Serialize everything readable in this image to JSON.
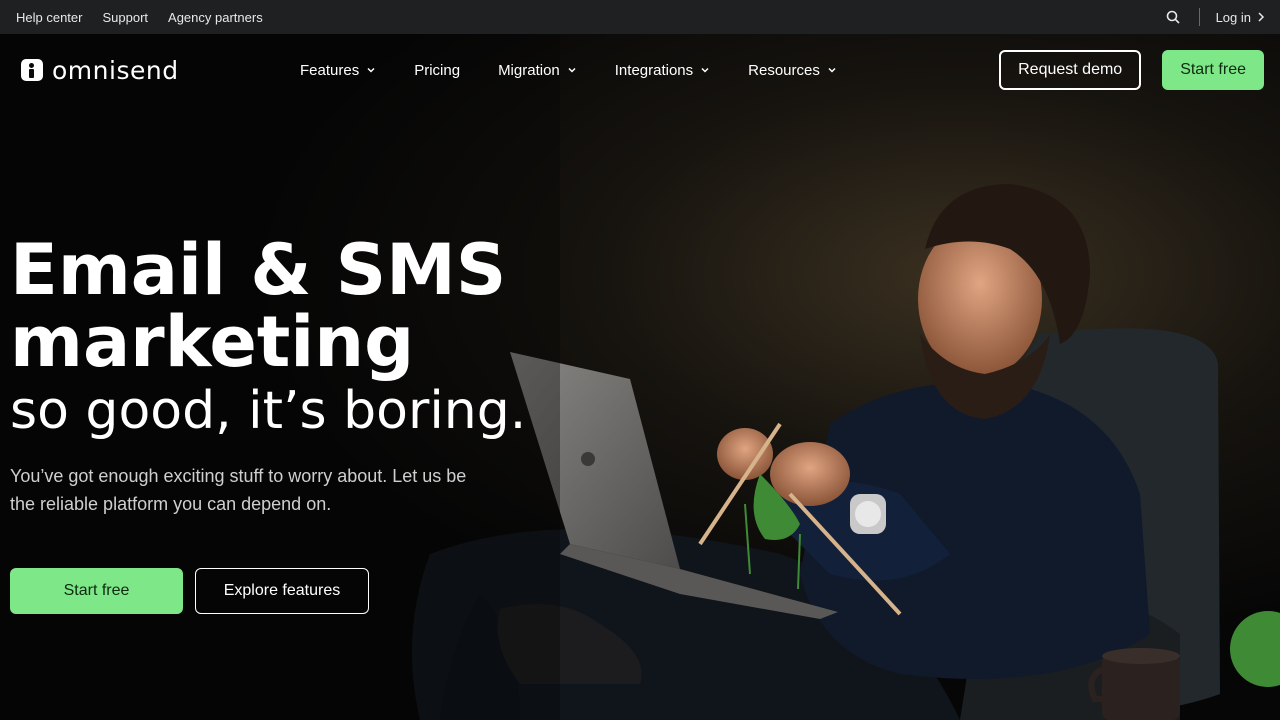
{
  "utility_bar": {
    "links": [
      "Help center",
      "Support",
      "Agency partners"
    ],
    "login_label": "Log in"
  },
  "nav": {
    "logo_text": "omnisend",
    "items": [
      {
        "label": "Features",
        "has_dropdown": true
      },
      {
        "label": "Pricing",
        "has_dropdown": false
      },
      {
        "label": "Migration",
        "has_dropdown": true
      },
      {
        "label": "Integrations",
        "has_dropdown": true
      },
      {
        "label": "Resources",
        "has_dropdown": true
      }
    ],
    "request_demo_label": "Request demo",
    "start_free_label": "Start free"
  },
  "hero": {
    "title_line1": "Email & SMS",
    "title_line2": "marketing",
    "subtitle": "so good, it’s boring.",
    "description": "You’ve got enough exciting stuff to worry about. Let us be the reliable platform you can depend on.",
    "primary_cta": "Start free",
    "secondary_cta": "Explore features"
  },
  "colors": {
    "accent_green": "#7ee787",
    "utility_bg": "#1f2021",
    "page_bg": "#070707"
  },
  "icons": [
    "search-icon",
    "chevron-right-icon",
    "chevron-down-icon",
    "omnisend-logo-icon"
  ]
}
